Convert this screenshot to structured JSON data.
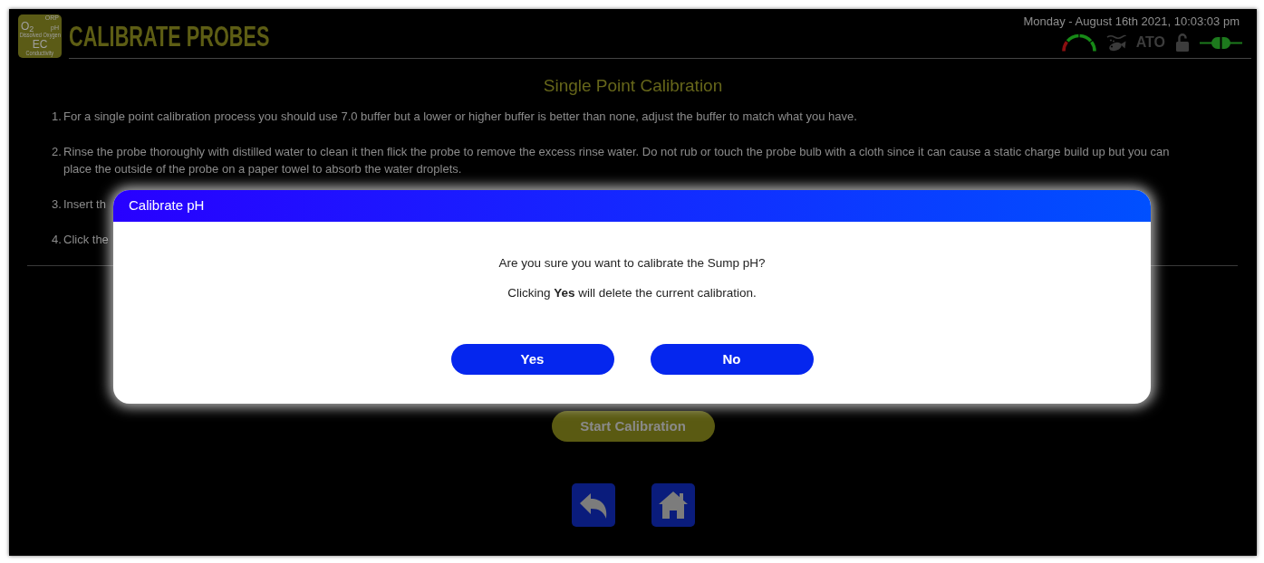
{
  "header": {
    "logo": {
      "top": "ORP",
      "left": "O$_{2}$",
      "right": "pH",
      "caption_1": "Dissolved Oxygen",
      "bottom": "EC",
      "caption_2": "Conductivity"
    },
    "title": "CALIBRATE PROBES",
    "datetime": "Monday - August 16th 2021, 10:03:03 pm",
    "status_icons": [
      {
        "kind": "gauge"
      },
      {
        "kind": "feeder",
        "on": false
      },
      {
        "kind": "ato",
        "label": "ATO",
        "on": false
      },
      {
        "kind": "lock",
        "locked": false
      },
      {
        "kind": "power",
        "on": true
      }
    ]
  },
  "page": {
    "heading": "Single Point Calibration",
    "steps": [
      {
        "number": "1.",
        "text": "For a single point calibration process you should use 7.0 buffer but a lower or higher buffer is better than none, adjust the buffer to match what you have."
      },
      {
        "number": "2.",
        "text": "Rinse the probe thoroughly with distilled water to clean it then flick the probe to remove the excess rinse water. Do not rub or touch the probe bulb with a cloth since it can cause a static charge build up but you can place the outside of the probe on a paper towel to absorb the water droplets."
      },
      {
        "number": "3.",
        "text": "Insert th"
      },
      {
        "number": "4.",
        "text": "Click the"
      }
    ],
    "start_button": "Start Calibration",
    "nav_buttons": [
      {
        "kind": "back"
      },
      {
        "kind": "home"
      }
    ]
  },
  "dialog": {
    "title": "Calibrate pH",
    "message": "Are you sure you want to calibrate the Sump pH?",
    "note": "Clicking **Yes** will delete the current calibration.",
    "buttons": [
      {
        "label": "Yes"
      },
      {
        "label": "No"
      }
    ]
  }
}
